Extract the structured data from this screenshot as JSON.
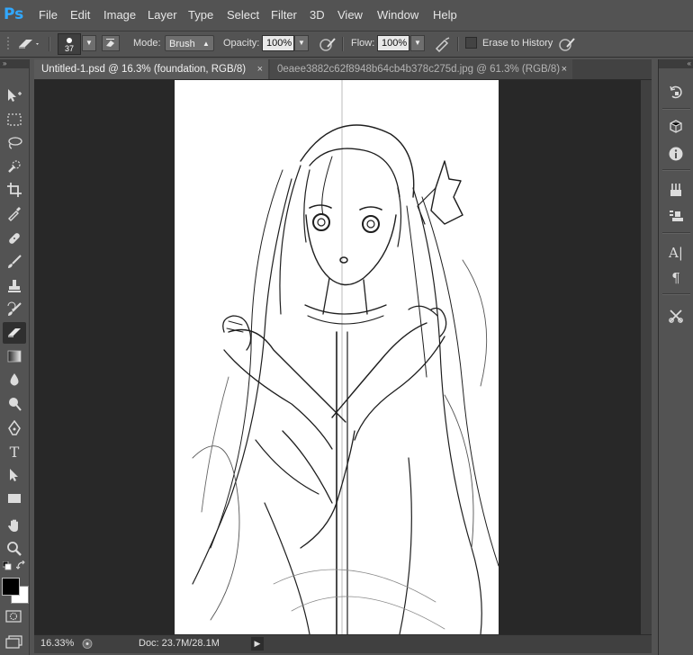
{
  "app": {
    "logo": "Ps"
  },
  "menu": [
    "File",
    "Edit",
    "Image",
    "Layer",
    "Type",
    "Select",
    "Filter",
    "3D",
    "View",
    "Window",
    "Help"
  ],
  "options": {
    "brush_size": "37",
    "mode_label": "Mode:",
    "mode_value": "Brush",
    "opacity_label": "Opacity:",
    "opacity_value": "100%",
    "flow_label": "Flow:",
    "flow_value": "100%",
    "erase_history_label": "Erase to History"
  },
  "tabs": [
    {
      "label": "Untitled-1.psd @ 16.3% (foundation, RGB/8)",
      "close": "×"
    },
    {
      "label": "0eaee3882c62f8948b64cb4b378c275d.jpg @ 61.3% (RGB/8)",
      "close": "×"
    }
  ],
  "status": {
    "zoom": "16.33%",
    "doc": "Doc: 23.7M/28.1M"
  },
  "tools": [
    "move-icon",
    "marquee-icon",
    "lasso-icon",
    "quick-select-icon",
    "crop-icon",
    "eyedropper-icon",
    "healing-brush-icon",
    "brush-icon",
    "clone-stamp-icon",
    "history-brush-icon",
    "eraser-icon",
    "gradient-icon",
    "blur-icon",
    "dodge-icon",
    "pen-icon",
    "type-icon",
    "path-select-icon",
    "rectangle-icon",
    "hand-icon",
    "zoom-icon"
  ],
  "colors": {
    "foreground": "#000000",
    "background": "#ffffff",
    "accent": "#31a8ff"
  },
  "canvas_content": "pencil line-art sketch of a long-haired girl with crossed arms"
}
